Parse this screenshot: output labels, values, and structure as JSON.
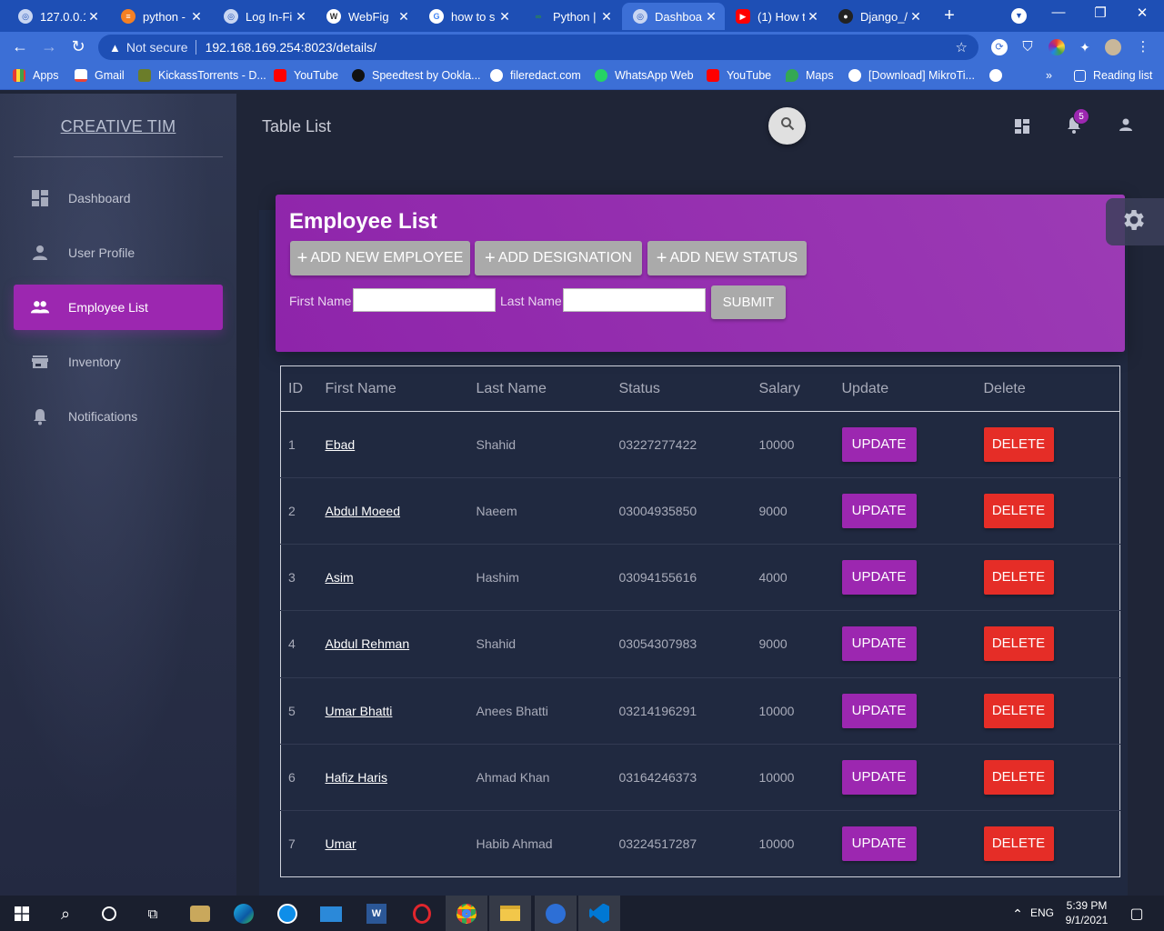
{
  "browser": {
    "tabs": [
      {
        "title": "127.0.0.1",
        "icon": "globe-icon"
      },
      {
        "title": "python -",
        "icon": "stackoverflow-icon"
      },
      {
        "title": "Log In-Fi",
        "icon": "globe-icon"
      },
      {
        "title": "WebFig",
        "icon": "mikrotik-icon"
      },
      {
        "title": "how to s",
        "icon": "google-icon"
      },
      {
        "title": "Python |",
        "icon": "geeksforgeeks-icon"
      },
      {
        "title": "Dashboa",
        "icon": "globe-icon"
      },
      {
        "title": "(1) How t",
        "icon": "youtube-icon"
      },
      {
        "title": "Django_/",
        "icon": "github-icon"
      }
    ],
    "active_tab_index": 6,
    "not_secure_label": "Not secure",
    "url": "192.168.169.254:8023/details/",
    "bookmarks": [
      {
        "label": "Apps",
        "icon": "apps-grid-icon"
      },
      {
        "label": "Gmail",
        "icon": "gmail-icon"
      },
      {
        "label": "KickassTorrents - D...",
        "icon": "kickass-icon"
      },
      {
        "label": "YouTube",
        "icon": "youtube-icon"
      },
      {
        "label": "Speedtest by Ookla...",
        "icon": "speedtest-icon"
      },
      {
        "label": "fileredact.com",
        "icon": "globe-icon"
      },
      {
        "label": "WhatsApp Web",
        "icon": "whatsapp-icon"
      },
      {
        "label": "YouTube",
        "icon": "youtube-icon"
      },
      {
        "label": "Maps",
        "icon": "maps-icon"
      },
      {
        "label": "[Download] MikroTi...",
        "icon": "globe-icon"
      }
    ],
    "more_bookmarks": "»",
    "reading_list_label": "Reading list"
  },
  "sidebar": {
    "brand": "CREATIVE TIM",
    "items": [
      {
        "label": "Dashboard",
        "icon": "dashboard-icon"
      },
      {
        "label": "User Profile",
        "icon": "person-icon"
      },
      {
        "label": "Employee List",
        "icon": "people-icon",
        "active": true
      },
      {
        "label": "Inventory",
        "icon": "store-icon"
      },
      {
        "label": "Notifications",
        "icon": "bell-icon"
      }
    ]
  },
  "header": {
    "page_title": "Table List",
    "notification_count": "5"
  },
  "employee_card": {
    "title": "Employee List",
    "add_employee_label": "ADD NEW EMPLOYEE",
    "add_designation_label": "ADD DESIGNATION",
    "add_status_label": "ADD NEW STATUS",
    "first_name_label": "First Name",
    "last_name_label": "Last Name",
    "first_name_value": "",
    "last_name_value": "",
    "submit_label": "SUBMIT"
  },
  "table": {
    "headers": [
      "ID",
      "First Name",
      "Last Name",
      "Status",
      "Salary",
      "Update",
      "Delete"
    ],
    "update_label": "UPDATE",
    "delete_label": "DELETE",
    "rows": [
      {
        "id": "1",
        "first_name": "Ebad",
        "last_name": "Shahid",
        "status": "03227277422",
        "salary": "10000"
      },
      {
        "id": "2",
        "first_name": "Abdul Moeed",
        "last_name": "Naeem",
        "status": "03004935850",
        "salary": "9000"
      },
      {
        "id": "3",
        "first_name": "Asim",
        "last_name": "Hashim",
        "status": "03094155616",
        "salary": "4000"
      },
      {
        "id": "4",
        "first_name": "Abdul Rehman",
        "last_name": "Shahid",
        "status": "03054307983",
        "salary": "9000"
      },
      {
        "id": "5",
        "first_name": "Umar Bhatti",
        "last_name": "Anees Bhatti",
        "status": "03214196291",
        "salary": "10000"
      },
      {
        "id": "6",
        "first_name": "Hafiz Haris",
        "last_name": "Ahmad Khan",
        "status": "03164246373",
        "salary": "10000"
      },
      {
        "id": "7",
        "first_name": "Umar",
        "last_name": "Habib Ahmad",
        "status": "03224517287",
        "salary": "10000"
      }
    ]
  },
  "taskbar": {
    "language": "ENG",
    "time": "5:39 PM",
    "date": "9/1/2021"
  },
  "colors": {
    "accent": "#9c27b0",
    "danger": "#e52d27",
    "background": "#1f2537",
    "chrome": "#3c6fd6"
  }
}
